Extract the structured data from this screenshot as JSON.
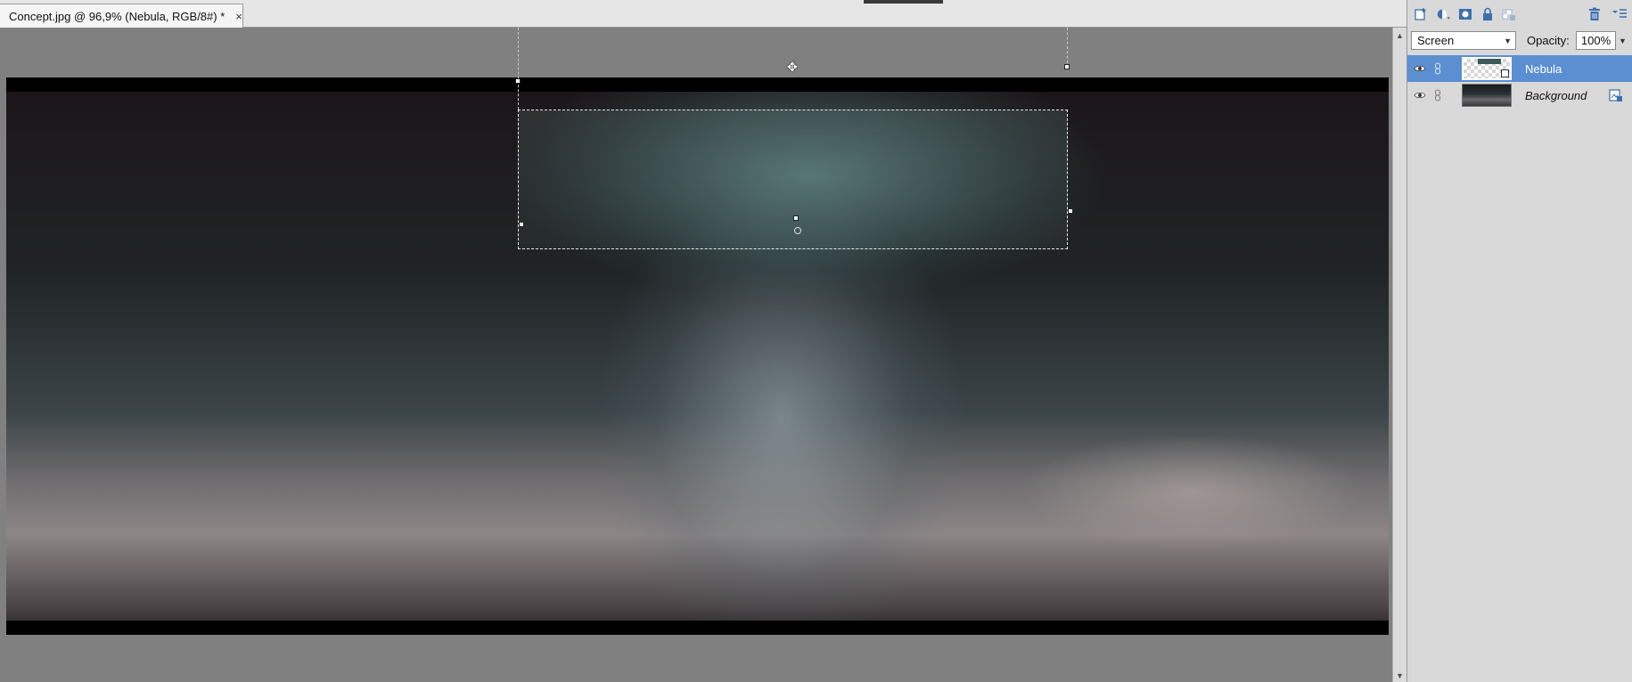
{
  "document_tab": {
    "title": "Concept.jpg @ 96,9% (Nebula, RGB/8#) *",
    "close_glyph": "×"
  },
  "canvas": {
    "artwork_description_icon": "image-canvas"
  },
  "layers_panel": {
    "toolbar_icons": [
      "new-layer-icon",
      "adjustment-layer-icon",
      "layer-mask-icon",
      "lock-icon",
      "lock-transparency-icon",
      "trash-icon",
      "panel-menu-icon"
    ],
    "blend_mode": "Screen",
    "opacity_label": "Opacity:",
    "opacity_value": "100%",
    "layers": [
      {
        "name": "Nebula",
        "visible": true,
        "selected": true
      },
      {
        "name": "Background",
        "visible": true,
        "selected": false,
        "locked": true
      }
    ]
  },
  "colors": {
    "selection": "#5b8fd2",
    "panel_bg": "#d9d9d9",
    "workspace_bg": "#808080"
  }
}
